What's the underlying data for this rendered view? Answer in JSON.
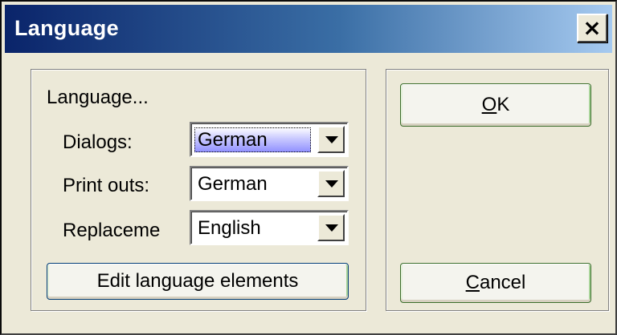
{
  "window": {
    "title": "Language",
    "close_label": "×"
  },
  "group": {
    "caption": "Language..."
  },
  "fields": {
    "dialogs_label": "Dialogs:",
    "dialogs_value": "German",
    "printouts_label": "Print outs:",
    "printouts_value": "German",
    "replacement_label": "Replaceme",
    "replacement_value": "English"
  },
  "buttons": {
    "edit_label": "Edit language elements",
    "ok_mnemonic": "O",
    "ok_rest": "K",
    "cancel_mnemonic": "C",
    "cancel_rest": "ancel"
  },
  "colors": {
    "titlebar_start": "#0a246a",
    "titlebar_end": "#a6caf0",
    "dialog_bg": "#ece9d8",
    "selection": "#8f8fff"
  }
}
